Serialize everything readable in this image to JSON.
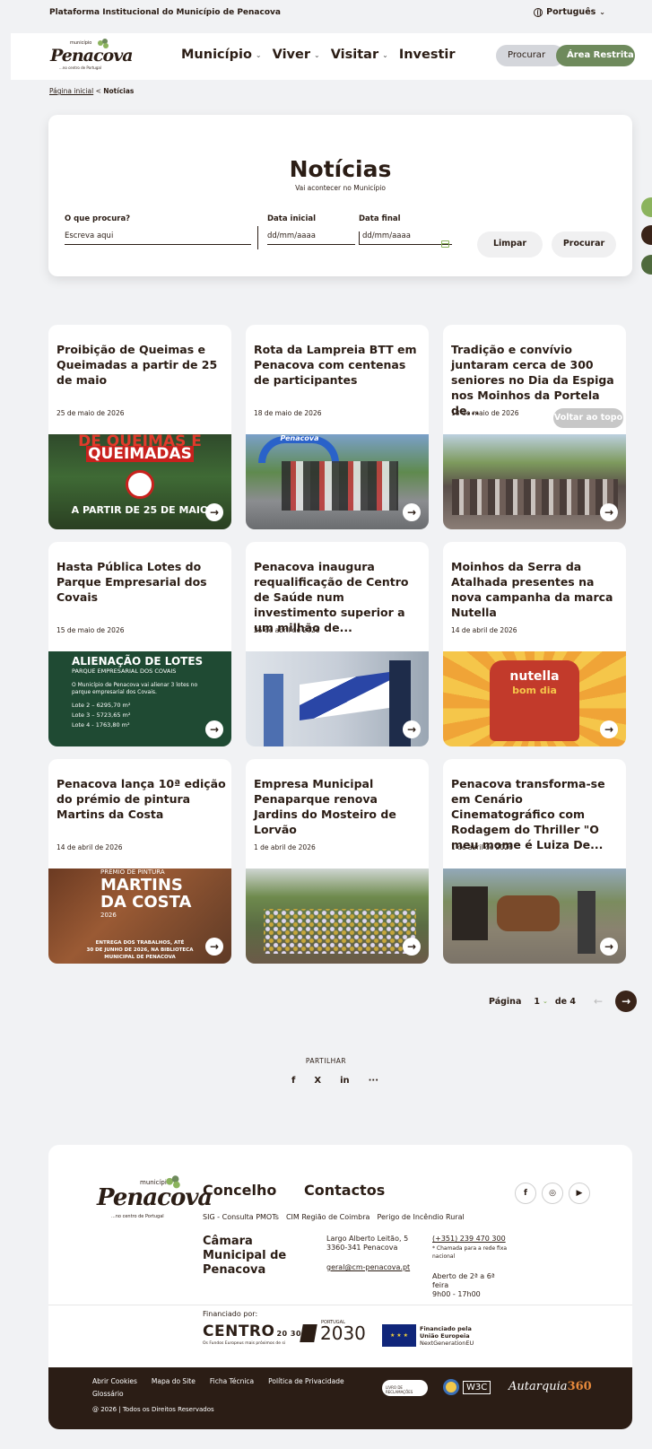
{
  "topbar": {
    "platform": "Plataforma Institucional do Município de Penacova",
    "language": "Português"
  },
  "header": {
    "logo": {
      "small": "município",
      "name": "Penacova",
      "tagline": "...no centro de Portugal"
    },
    "nav": [
      {
        "label": "Município",
        "has_dropdown": true
      },
      {
        "label": "Viver",
        "has_dropdown": true
      },
      {
        "label": "Visitar",
        "has_dropdown": true
      },
      {
        "label": "Investir",
        "has_dropdown": false
      }
    ],
    "search_label": "Procurar",
    "restricted_label": "Área Restrita"
  },
  "breadcrumb": {
    "home": "Página inicial",
    "separator": "<",
    "current": "Notícias"
  },
  "hero": {
    "title": "Notícias",
    "subtitle": "Vai acontecer no Município",
    "filters": {
      "what_label": "O que procura?",
      "what_placeholder": "Escreva aqui",
      "start_label": "Data inicial",
      "start_placeholder": "dd/mm/aaaa",
      "end_label": "Data final",
      "end_placeholder": "dd/mm/aaaa",
      "clear_label": "Limpar",
      "search_label": "Procurar"
    }
  },
  "back_to_top": "Voltar ao topo",
  "news": [
    {
      "title": "Proibição de Queimas e Queimadas a partir de 25 de maio",
      "date": "25 de maio de 2026",
      "img_caption": [
        "DE QUEIMAS E",
        "QUEIMADAS",
        "A PARTIR DE 25 DE MAIO"
      ]
    },
    {
      "title": "Rota da Lampreia BTT em Penacova com centenas de participantes",
      "date": "18 de maio de 2026",
      "img_caption": [
        "Penacova"
      ]
    },
    {
      "title": "Tradição e convívio juntaram cerca de 300 seniores no Dia da Espiga nos Moinhos da Portela de...",
      "date": "18 de maio de 2026",
      "img_caption": []
    },
    {
      "title": "Hasta Pública Lotes do Parque Empresarial dos Covais",
      "date": "15 de maio de 2026",
      "img_caption": [
        "ALIENAÇÃO DE LOTES",
        "PARQUE EMPRESARIAL DOS COVAIS",
        "O Município de Penacova vai alienar 3 lotes no parque empresarial dos Covais.",
        "Lote 2 – 6295,70 m²",
        "Lote 3 – 5723,65 m²",
        "Lote 4 - 1763,80 m²"
      ]
    },
    {
      "title": "Penacova inaugura requalificação de Centro de Saúde num investimento superior a um milhão de...",
      "date": "25 de abril de 2026",
      "img_caption": []
    },
    {
      "title": "Moinhos da Serra da Atalhada presentes na nova campanha da marca Nutella",
      "date": "14 de abril de 2026",
      "img_caption": [
        "nutella",
        "bom dia"
      ]
    },
    {
      "title": "Penacova lança 10ª edição do prémio de pintura Martins da Costa",
      "date": "14 de abril de 2026",
      "img_caption": [
        "PRÉMIO DE PINTURA",
        "MARTINS",
        "DA COSTA",
        "2026",
        "ENTREGA DOS TRABALHOS, ATÉ",
        "30 DE JUNHO DE 2026, NA BIBLIOTECA",
        "MUNICIPAL DE PENACOVA"
      ]
    },
    {
      "title": "Empresa Municipal Penaparque renova Jardins do Mosteiro de Lorvão",
      "date": "1 de abril de 2026",
      "img_caption": []
    },
    {
      "title": "Penacova transforma-se em Cenário Cinematográfico com Rodagem do Thriller \"O meu mome é Luiza De...",
      "date": "1 de abril de 2026",
      "img_caption": []
    }
  ],
  "pagination": {
    "label": "Página",
    "current": "1",
    "of_label": "de 4"
  },
  "share": {
    "label": "PARTILHAR",
    "items": [
      "f",
      "X",
      "in",
      "···"
    ]
  },
  "footer": {
    "logo": {
      "small": "município",
      "name": "Penacova",
      "tagline": "...no centro de Portugal"
    },
    "concelho": "Concelho",
    "contactos": "Contactos",
    "links": [
      "SIG - Consulta PMOTs",
      "CIM Região de Coimbra",
      "Perigo de Incêndio Rural"
    ],
    "camara": "Câmara Municipal de Penacova",
    "address_line1": "Largo Alberto Leitão, 5",
    "address_line2": "3360-341 Penacova",
    "email": "geral@cm-penacova.pt",
    "phone": "(+351) 239 470 300",
    "phone_note": "* Chamada para a rede fixa nacional",
    "hours_line1": "Aberto de 2ª a 6ª feira",
    "hours_line2": "9h00 - 17h00",
    "financed": "Financiado por:",
    "centro": "CENTRO",
    "centro_year": "20 30",
    "centro_sub": "Os Fundos Europeus mais próximos de si",
    "portugal_small": "PORTUGAL",
    "portugal_year": "2030",
    "eu_line1": "Financiado pela",
    "eu_line2": "União Europeia",
    "eu_line3": "NextGenerationEU",
    "bottom_links": [
      "Abrir Cookies",
      "Mapa do Site",
      "Ficha Técnica",
      "Política de Privacidade"
    ],
    "glossary": "Glossário",
    "copyright": "@ 2026 | Todos os Direitos Reservados",
    "badge_text": "LIVRO DE RECLAMAÇÕES",
    "w3c": "W3C",
    "autarquia": "Autarquia",
    "autarquia_num": "360"
  },
  "colors": {
    "brown": "#2b1d15",
    "green": "#8bb35d",
    "olive": "#6e8a5c",
    "bg": "#f1f2f4"
  }
}
